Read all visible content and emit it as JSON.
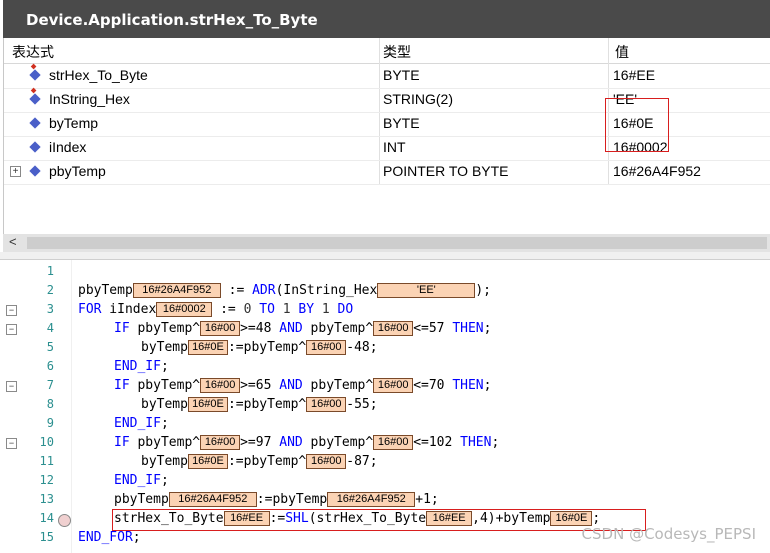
{
  "title": "Device.Application.strHex_To_Byte",
  "watch": {
    "headers": [
      "表达式",
      "类型",
      "值"
    ],
    "rows": [
      {
        "expr": "strHex_To_Byte",
        "type": "BYTE",
        "value": "16#EE"
      },
      {
        "expr": "InString_Hex",
        "type": "STRING(2)",
        "value": "'EE'"
      },
      {
        "expr": "byTemp",
        "type": "BYTE",
        "value": "16#0E"
      },
      {
        "expr": "iIndex",
        "type": "INT",
        "value": "16#0002"
      },
      {
        "expr": "pbyTemp",
        "type": "POINTER TO BYTE",
        "value": "16#26A4F952"
      }
    ]
  },
  "line_numbers": [
    "1",
    "2",
    "3",
    "4",
    "5",
    "6",
    "7",
    "8",
    "9",
    "10",
    "11",
    "12",
    "13",
    "14",
    "15"
  ],
  "code": {
    "l2": {
      "a": "pbyTemp",
      "v1": "16#26A4F952",
      "b": " := ",
      "adr": "ADR",
      "c": "(InString_Hex",
      "v2": "'EE'",
      "d": ");"
    },
    "l3": {
      "for": "FOR",
      "a": " iIndex",
      "v1": "16#0002",
      "b": " := ",
      "n0": "0",
      "to": " TO ",
      "n1": "1",
      "by": " BY ",
      "n2": "1",
      "do": " DO"
    },
    "l4": {
      "if": "IF",
      "a": " pbyTemp^",
      "v1": "16#00",
      "b": ">=48 ",
      "and": "AND",
      "c": " pbyTemp^",
      "v2": "16#00",
      "d": "<=57 ",
      "then": "THEN",
      "e": ";"
    },
    "l5": {
      "a": "byTemp",
      "v1": "16#0E",
      "b": ":=pbyTemp^",
      "v2": "16#00",
      "c": "-48;"
    },
    "l6": {
      "endif": "END_IF",
      "a": ";"
    },
    "l7": {
      "if": "IF",
      "a": " pbyTemp^",
      "v1": "16#00",
      "b": ">=65 ",
      "and": "AND",
      "c": " pbyTemp^",
      "v2": "16#00",
      "d": "<=70 ",
      "then": "THEN",
      "e": ";"
    },
    "l8": {
      "a": "byTemp",
      "v1": "16#0E",
      "b": ":=pbyTemp^",
      "v2": "16#00",
      "c": "-55;"
    },
    "l9": {
      "endif": "END_IF",
      "a": ";"
    },
    "l10": {
      "if": "IF",
      "a": " pbyTemp^",
      "v1": "16#00",
      "b": ">=97 ",
      "and": "AND",
      "c": " pbyTemp^",
      "v2": "16#00",
      "d": "<=102 ",
      "then": "THEN",
      "e": ";"
    },
    "l11": {
      "a": "byTemp",
      "v1": "16#0E",
      "b": ":=pbyTemp^",
      "v2": "16#00",
      "c": "-87;"
    },
    "l12": {
      "endif": "END_IF",
      "a": ";"
    },
    "l13": {
      "a": "pbyTemp",
      "v1": "16#26A4F952",
      "b": ":=pbyTemp",
      "v2": "16#26A4F952",
      "c": "+1;"
    },
    "l14": {
      "a": "strHex_To_Byte",
      "v1": "16#EE",
      "b": ":=",
      "shl": "SHL",
      "c": "(strHex_To_Byte",
      "v2": "16#EE",
      "d": ",4)+byTemp",
      "v3": "16#0E",
      "e": ";"
    },
    "l15": {
      "endfor": "END_FOR",
      "a": ";"
    }
  },
  "watermark": "CSDN @Codesys_PEPSI"
}
